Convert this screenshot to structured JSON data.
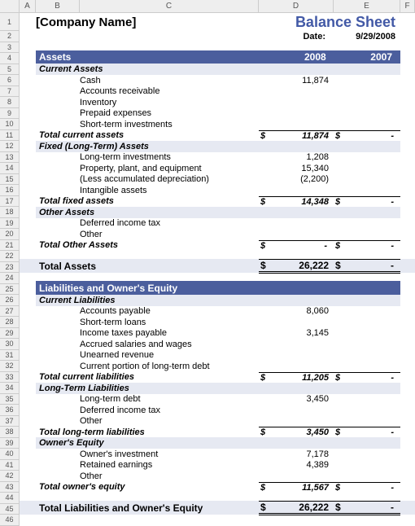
{
  "header": {
    "company": "[Company Name]",
    "title": "Balance Sheet",
    "date_label": "Date:",
    "date_value": "9/29/2008"
  },
  "col_headers": [
    "A",
    "B",
    "C",
    "D",
    "E",
    "F"
  ],
  "years": {
    "current": "2008",
    "prior": "2007"
  },
  "assets": {
    "title": "Assets",
    "current": {
      "title": "Current Assets",
      "items": [
        {
          "label": "Cash",
          "v2008": "11,874",
          "v2007": ""
        },
        {
          "label": "Accounts receivable",
          "v2008": "",
          "v2007": ""
        },
        {
          "label": "Inventory",
          "v2008": "",
          "v2007": ""
        },
        {
          "label": "Prepaid expenses",
          "v2008": "",
          "v2007": ""
        },
        {
          "label": "Short-term investments",
          "v2008": "",
          "v2007": ""
        }
      ],
      "total_label": "Total current assets",
      "total_2008": "11,874",
      "total_2007": "-"
    },
    "fixed": {
      "title": "Fixed (Long-Term) Assets",
      "items": [
        {
          "label": "Long-term investments",
          "v2008": "1,208",
          "v2007": ""
        },
        {
          "label": "Property, plant, and equipment",
          "v2008": "15,340",
          "v2007": ""
        },
        {
          "label": "(Less accumulated depreciation)",
          "v2008": "(2,200)",
          "v2007": ""
        },
        {
          "label": "Intangible assets",
          "v2008": "",
          "v2007": ""
        }
      ],
      "total_label": "Total fixed assets",
      "total_2008": "14,348",
      "total_2007": "-"
    },
    "other": {
      "title": "Other Assets",
      "items": [
        {
          "label": "Deferred income tax",
          "v2008": "",
          "v2007": ""
        },
        {
          "label": "Other",
          "v2008": "",
          "v2007": ""
        }
      ],
      "total_label": "Total Other Assets",
      "total_2008": "-",
      "total_2007": "-"
    },
    "grand_label": "Total Assets",
    "grand_2008": "26,222",
    "grand_2007": "-"
  },
  "liab_equity": {
    "title": "Liabilities and Owner's Equity",
    "current": {
      "title": "Current Liabilities",
      "items": [
        {
          "label": "Accounts payable",
          "v2008": "8,060",
          "v2007": ""
        },
        {
          "label": "Short-term loans",
          "v2008": "",
          "v2007": ""
        },
        {
          "label": "Income taxes payable",
          "v2008": "3,145",
          "v2007": ""
        },
        {
          "label": "Accrued salaries and wages",
          "v2008": "",
          "v2007": ""
        },
        {
          "label": "Unearned revenue",
          "v2008": "",
          "v2007": ""
        },
        {
          "label": "Current portion of long-term debt",
          "v2008": "",
          "v2007": ""
        }
      ],
      "total_label": "Total current liabilities",
      "total_2008": "11,205",
      "total_2007": "-"
    },
    "longterm": {
      "title": "Long-Term Liabilities",
      "items": [
        {
          "label": "Long-term debt",
          "v2008": "3,450",
          "v2007": ""
        },
        {
          "label": "Deferred income tax",
          "v2008": "",
          "v2007": ""
        },
        {
          "label": "Other",
          "v2008": "",
          "v2007": ""
        }
      ],
      "total_label": "Total long-term liabilities",
      "total_2008": "3,450",
      "total_2007": "-"
    },
    "equity": {
      "title": "Owner's Equity",
      "items": [
        {
          "label": "Owner's investment",
          "v2008": "7,178",
          "v2007": ""
        },
        {
          "label": "Retained earnings",
          "v2008": "4,389",
          "v2007": ""
        },
        {
          "label": "Other",
          "v2008": "",
          "v2007": ""
        }
      ],
      "total_label": "Total owner's equity",
      "total_2008": "11,567",
      "total_2007": "-"
    },
    "grand_label": "Total Liabilities and Owner's Equity",
    "grand_2008": "26,222",
    "grand_2007": "-"
  },
  "currency": "$"
}
